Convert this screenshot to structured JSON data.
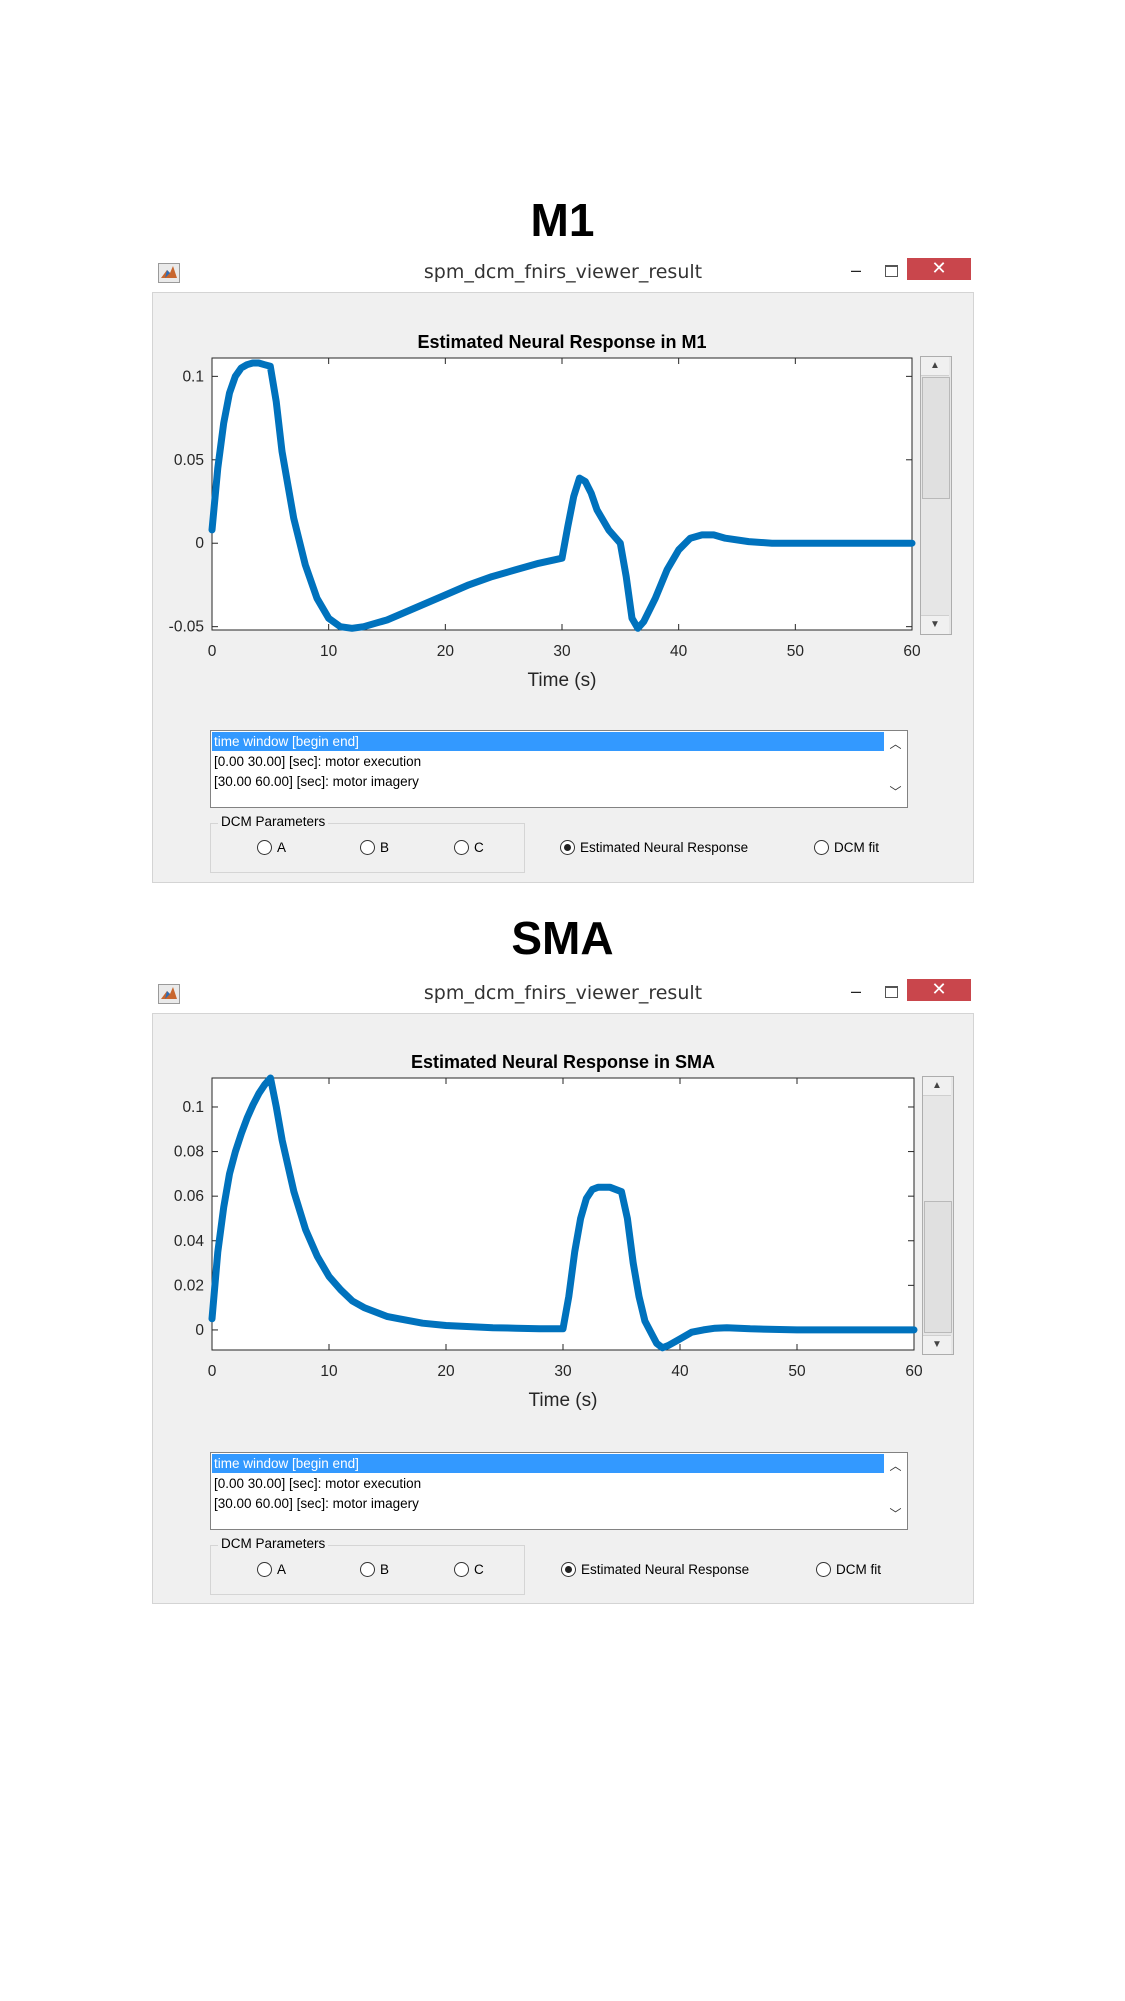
{
  "headings": [
    "M1",
    "SMA"
  ],
  "windows": [
    {
      "title": "spm_dcm_fnirs_viewer_result",
      "minimize_glyph": "–",
      "close_glyph": "✕",
      "listbox": {
        "items": [
          "time window [begin end]",
          "[0.00 30.00] [sec]: motor execution",
          "[30.00 60.00] [sec]: motor imagery"
        ],
        "selected_index": 0
      },
      "params_group_title": "DCM Parameters",
      "radios": [
        {
          "label": "A",
          "checked": false
        },
        {
          "label": "B",
          "checked": false
        },
        {
          "label": "C",
          "checked": false
        },
        {
          "label": "Estimated Neural Response",
          "checked": true
        },
        {
          "label": "DCM fit",
          "checked": false
        }
      ]
    },
    {
      "title": "spm_dcm_fnirs_viewer_result",
      "minimize_glyph": "–",
      "close_glyph": "✕",
      "listbox": {
        "items": [
          "time window [begin end]",
          "[0.00 30.00] [sec]: motor execution",
          "[30.00 60.00] [sec]: motor imagery"
        ],
        "selected_index": 0
      },
      "params_group_title": "DCM Parameters",
      "radios": [
        {
          "label": "A",
          "checked": false
        },
        {
          "label": "B",
          "checked": false
        },
        {
          "label": "C",
          "checked": false
        },
        {
          "label": "Estimated Neural Response",
          "checked": true
        },
        {
          "label": "DCM fit",
          "checked": false
        }
      ]
    }
  ],
  "chart_data": [
    {
      "type": "line",
      "title": "Estimated Neural Response in M1",
      "xlabel": "Time (s)",
      "ylabel": "",
      "xlim": [
        0,
        60
      ],
      "ylim": [
        -0.052,
        0.111
      ],
      "xticks": [
        "0",
        "10",
        "20",
        "30",
        "40",
        "50",
        "60"
      ],
      "yticks": [
        "-0.05",
        "0",
        "0.05",
        "0.1"
      ],
      "grid": false,
      "line_color": "#0072bd",
      "series": [
        {
          "x": [
            0,
            0.5,
            1,
            1.5,
            2,
            2.5,
            3,
            3.5,
            4,
            4.5,
            5,
            5.5,
            6,
            7,
            8,
            9,
            10,
            11,
            12,
            13,
            14,
            15,
            16,
            18,
            20,
            22,
            24,
            26,
            28,
            30,
            30.5,
            31,
            31.5,
            32,
            32.5,
            33,
            34,
            35,
            35.5,
            36,
            36.5,
            37,
            38,
            39,
            40,
            41,
            42,
            43,
            44,
            46,
            48,
            50,
            55,
            60
          ],
          "y": [
            0.008,
            0.045,
            0.072,
            0.09,
            0.1,
            0.105,
            0.107,
            0.108,
            0.108,
            0.107,
            0.106,
            0.085,
            0.055,
            0.015,
            -0.013,
            -0.033,
            -0.045,
            -0.05,
            -0.051,
            -0.05,
            -0.048,
            -0.046,
            -0.043,
            -0.037,
            -0.031,
            -0.025,
            -0.02,
            -0.016,
            -0.012,
            -0.009,
            0.01,
            0.028,
            0.039,
            0.037,
            0.03,
            0.02,
            0.008,
            0.0,
            -0.02,
            -0.045,
            -0.051,
            -0.047,
            -0.033,
            -0.016,
            -0.004,
            0.003,
            0.005,
            0.005,
            0.003,
            0.001,
            0.0,
            0.0,
            0.0,
            0.0
          ]
        }
      ]
    },
    {
      "type": "line",
      "title": "Estimated Neural Response in SMA",
      "xlabel": "Time (s)",
      "ylabel": "",
      "xlim": [
        0,
        60
      ],
      "ylim": [
        -0.009,
        0.113
      ],
      "xticks": [
        "0",
        "10",
        "20",
        "30",
        "40",
        "50",
        "60"
      ],
      "yticks": [
        "0",
        "0.02",
        "0.04",
        "0.06",
        "0.08",
        "0.1"
      ],
      "grid": false,
      "line_color": "#0072bd",
      "series": [
        {
          "x": [
            0,
            0.5,
            1,
            1.5,
            2,
            2.5,
            3,
            3.5,
            4,
            4.5,
            5,
            5.5,
            6,
            7,
            8,
            9,
            10,
            11,
            12,
            13,
            14,
            15,
            16,
            18,
            20,
            22,
            24,
            26,
            28,
            30,
            30.5,
            31,
            31.5,
            32,
            32.5,
            33,
            34,
            35,
            35.5,
            36,
            36.5,
            37,
            38,
            38.5,
            39,
            40,
            41,
            42,
            43,
            44,
            46,
            50,
            55,
            60
          ],
          "y": [
            0.005,
            0.035,
            0.055,
            0.07,
            0.08,
            0.088,
            0.095,
            0.101,
            0.106,
            0.11,
            0.113,
            0.1,
            0.085,
            0.062,
            0.045,
            0.033,
            0.024,
            0.018,
            0.013,
            0.01,
            0.008,
            0.006,
            0.005,
            0.003,
            0.002,
            0.0015,
            0.001,
            0.0008,
            0.0005,
            0.0005,
            0.015,
            0.035,
            0.05,
            0.059,
            0.063,
            0.064,
            0.064,
            0.062,
            0.05,
            0.03,
            0.015,
            0.004,
            -0.006,
            -0.008,
            -0.007,
            -0.004,
            -0.001,
            0.0,
            0.0008,
            0.001,
            0.0005,
            0.0,
            0.0,
            0.0
          ]
        }
      ]
    }
  ]
}
